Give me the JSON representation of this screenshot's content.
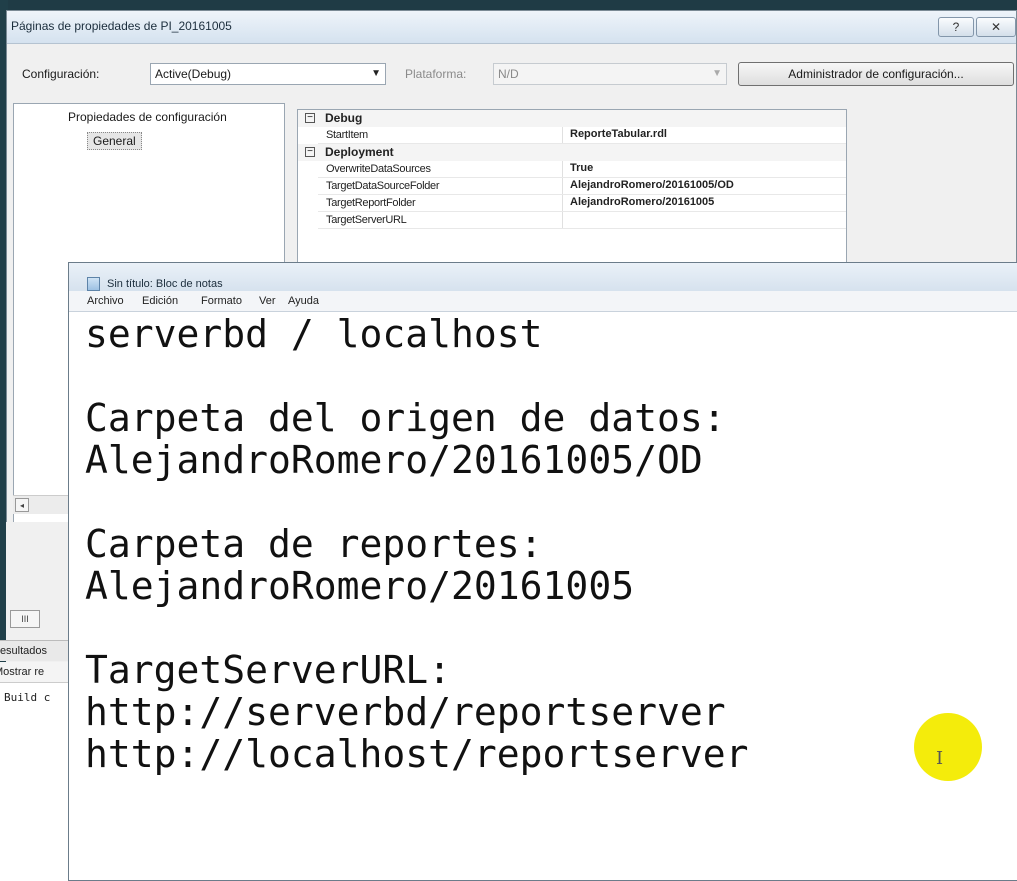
{
  "property_window": {
    "title": "Páginas de propiedades de PI_20161005",
    "help_symbol": "?",
    "close_symbol": "✕",
    "config_label": "Configuración:",
    "config_value": "Active(Debug)",
    "platform_label": "Plataforma:",
    "platform_value": "N/D",
    "config_manager_button": "Administrador de configuración...",
    "tree": {
      "root": "Propiedades de configuración",
      "child": "General"
    },
    "grid": {
      "categories": [
        {
          "name": "Debug",
          "collapse_symbol": "−"
        },
        {
          "name": "Deployment",
          "collapse_symbol": "−"
        }
      ],
      "debug_rows": [
        {
          "key": "StartItem",
          "value": "ReporteTabular.rdl"
        }
      ],
      "deployment_rows": [
        {
          "key": "OverwriteDataSources",
          "value": "True"
        },
        {
          "key": "TargetDataSourceFolder",
          "value": "AlejandroRomero/20161005/OD"
        },
        {
          "key": "TargetReportFolder",
          "value": "AlejandroRomero/20161005"
        },
        {
          "key": "TargetServerURL",
          "value": ""
        }
      ]
    },
    "scroll_left_symbol": "◂",
    "strip_scroll_symbol": "III",
    "output": {
      "tab_label": "Resultados",
      "mostrar_label": "Mostrar re",
      "build_text": "Build c"
    }
  },
  "notepad": {
    "title": "Sin título: Bloc de notas",
    "menu": [
      "Archivo",
      "Edición",
      "Formato",
      "Ver",
      "Ayuda"
    ],
    "lines": [
      "serverbd / localhost",
      "",
      "Carpeta del origen de datos:",
      "AlejandroRomero/20161005/OD",
      "",
      "Carpeta de reportes:",
      "AlejandroRomero/20161005",
      "",
      "TargetServerURL:",
      "http://serverbd/reportserver",
      "http://localhost/reportserver"
    ]
  },
  "colors": {
    "background": "#1f3b45",
    "cursor_highlight": "#f4ec0b"
  }
}
